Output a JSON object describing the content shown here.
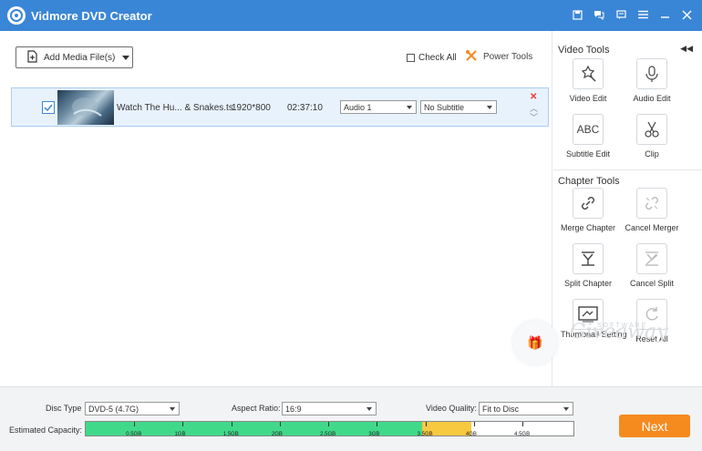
{
  "app": {
    "title": "Vidmore DVD Creator"
  },
  "titlebar": {
    "icons": [
      "save-icon",
      "chat-icon",
      "feedback-icon",
      "menu-icon",
      "minimize-icon",
      "close-icon"
    ]
  },
  "toolbar": {
    "add_media_label": "Add Media File(s)",
    "check_all_label": "Check All",
    "power_tools_label": "Power Tools"
  },
  "file": {
    "name": "Watch The Hu... & Snakes.ts",
    "resolution": "1920*800",
    "duration": "02:37:10",
    "audio": "Audio 1",
    "subtitle": "No Subtitle"
  },
  "video_tools": {
    "title": "Video Tools",
    "items": [
      "Video Edit",
      "Audio Edit",
      "Subtitle Edit",
      "Clip"
    ]
  },
  "chapter_tools": {
    "title": "Chapter Tools",
    "items": [
      "Merge Chapter",
      "Cancel Merger",
      "Split Chapter",
      "Cancel Split",
      "Thumbnail Setting",
      "Reset All"
    ]
  },
  "bottom": {
    "disc_type_label": "Disc Type",
    "disc_type_value": "DVD-5 (4.7G)",
    "aspect_label": "Aspect Ratio:",
    "aspect_value": "16:9",
    "quality_label": "Video Quality:",
    "quality_value": "Fit to Disc",
    "capacity_label": "Estimated Capacity:",
    "capacity_ticks": [
      "0.5GB",
      "1GB",
      "1.5GB",
      "2GB",
      "2.5GB",
      "3GB",
      "3.5GB",
      "4GB",
      "4.5GB"
    ],
    "capacity_fill_fraction": 0.79,
    "capacity_warn_fraction": 0.1,
    "next_label": "Next"
  },
  "watermark": {
    "text": "Giveaway",
    "small": "SOFTWARE"
  },
  "colors": {
    "titlebar": "#3a86d6",
    "accent": "#f58a1f",
    "capacity_ok": "#40d98a",
    "capacity_warn": "#f7c940"
  }
}
